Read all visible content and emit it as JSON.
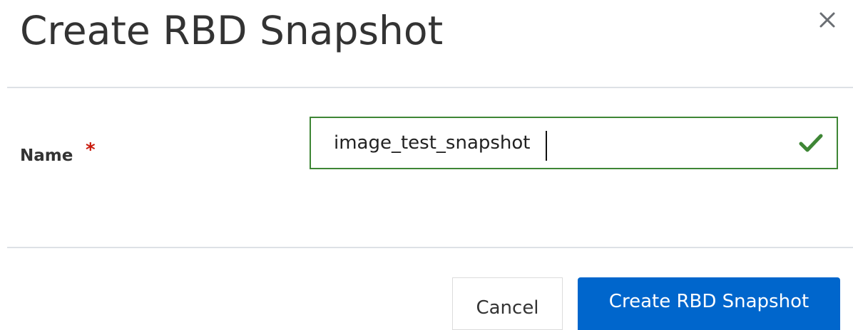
{
  "dialog": {
    "title": "Create RBD Snapshot",
    "close_icon": "close-icon"
  },
  "form": {
    "name_label": "Name",
    "required_marker": "*",
    "name_value": "image_test_snapshot",
    "valid_icon": "check-icon",
    "valid_color": "#3e8635"
  },
  "footer": {
    "cancel_label": "Cancel",
    "submit_label": "Create RBD Snapshot",
    "submit_color": "#0066cc"
  }
}
